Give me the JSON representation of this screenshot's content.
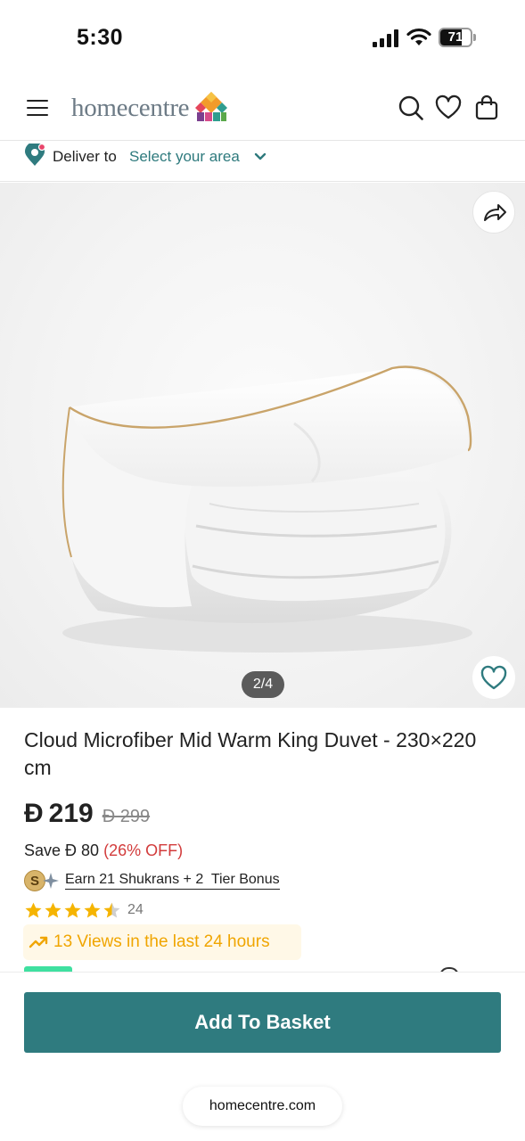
{
  "status_bar": {
    "time": "5:30",
    "battery_level": "71",
    "icons": [
      "signal-icon",
      "wifi-icon",
      "battery-icon"
    ]
  },
  "header": {
    "logo_text": "homecentre",
    "icons": [
      "menu-icon",
      "search-icon",
      "heart-icon",
      "shopping-bag-icon"
    ]
  },
  "delivery": {
    "label": "Deliver to",
    "area": "Select your area",
    "icons": [
      "location-pin-icon",
      "chevron-down-icon"
    ]
  },
  "gallery": {
    "image_subject": "folded white duvet",
    "page_indicator": "2/4",
    "icons": [
      "share-icon",
      "heart-outline-icon"
    ]
  },
  "product": {
    "title": "Cloud Microfiber Mid Warm King Duvet - 230×220 cm",
    "currency_symbol": "Đ",
    "price": "219",
    "old_price": "Đ 299",
    "save_label": "Save",
    "save_amount": "Đ 80",
    "save_percent": "(26% OFF)",
    "shukran_text": "Earn 21 Shukrans + 2  Tier Bonus",
    "rating": 4.5,
    "rating_count": "24",
    "views_text": "13 Views in the last 24 hours"
  },
  "actions": {
    "add_to_basket": "Add To Basket"
  },
  "browser": {
    "url": "homecentre.com"
  },
  "colors": {
    "brand_teal": "#2f7b7f",
    "link_teal": "#2e7a7d",
    "discount_red": "#d23b3b",
    "views_amber": "#f0a500",
    "star_gold": "#f5b400"
  }
}
